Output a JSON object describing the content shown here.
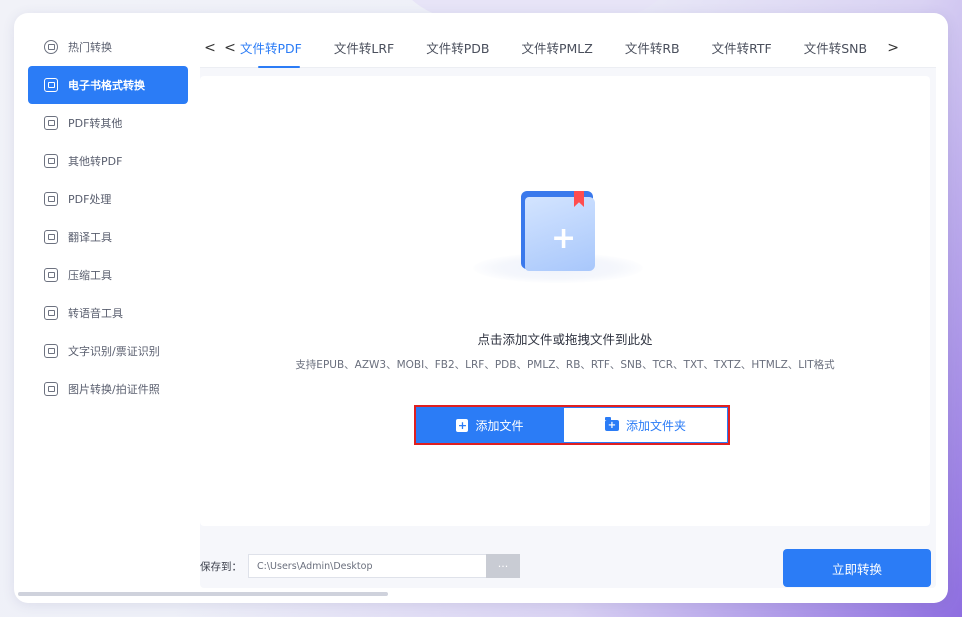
{
  "sidebar": {
    "items": [
      {
        "label": "热门转换",
        "icon": "fire-icon",
        "active": false
      },
      {
        "label": "电子书格式转换",
        "icon": "ebook-icon",
        "active": true
      },
      {
        "label": "PDF转其他",
        "icon": "pdf-export-icon",
        "active": false
      },
      {
        "label": "其他转PDF",
        "icon": "pdf-import-icon",
        "active": false
      },
      {
        "label": "PDF处理",
        "icon": "pdf-edit-icon",
        "active": false
      },
      {
        "label": "翻译工具",
        "icon": "translate-icon",
        "active": false
      },
      {
        "label": "压缩工具",
        "icon": "compress-icon",
        "active": false
      },
      {
        "label": "转语音工具",
        "icon": "speech-icon",
        "active": false
      },
      {
        "label": "文字识别/票证识别",
        "icon": "ocr-icon",
        "active": false
      },
      {
        "label": "图片转换/拍证件照",
        "icon": "image-icon",
        "active": false
      }
    ]
  },
  "tabs": {
    "prev1": "<",
    "prev2": "<",
    "next": ">",
    "items": [
      "文件转PDF",
      "文件转LRF",
      "文件转PDB",
      "文件转PMLZ",
      "文件转RB",
      "文件转RTF",
      "文件转SNB"
    ],
    "active_index": 0
  },
  "dropzone": {
    "title": "点击添加文件或拖拽文件到此处",
    "supported": "支持EPUB、AZW3、MOBI、FB2、LRF、PDB、PMLZ、RB、RTF、SNB、TCR、TXT、TXTZ、HTMLZ、LIT格式",
    "add_file_label": "添加文件",
    "add_folder_label": "添加文件夹",
    "plus_glyph": "+"
  },
  "footer": {
    "save_label": "保存到：",
    "path_value": "C:\\Users\\Admin\\Desktop",
    "browse_label": "···",
    "convert_label": "立即转换"
  },
  "colors": {
    "accent": "#2b7cf6",
    "highlight_box": "#e02020",
    "bookmark": "#ff4d4f"
  }
}
